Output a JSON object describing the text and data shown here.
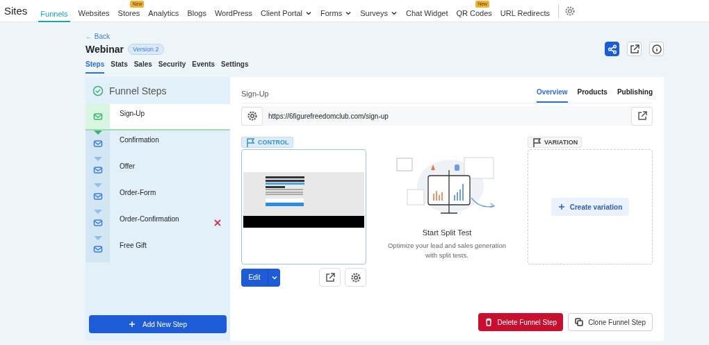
{
  "topnav": {
    "brand": "Sites",
    "items": [
      {
        "label": "Funnels",
        "selected": true,
        "dropdown": false
      },
      {
        "label": "Websites",
        "selected": false,
        "dropdown": false
      },
      {
        "label": "Stores",
        "selected": false,
        "badge": "New",
        "dropdown": false
      },
      {
        "label": "Analytics",
        "selected": false,
        "dropdown": false
      },
      {
        "label": "Blogs",
        "selected": false,
        "dropdown": false
      },
      {
        "label": "WordPress",
        "selected": false,
        "dropdown": false
      },
      {
        "label": "Client Portal",
        "selected": false,
        "dropdown": true
      },
      {
        "label": "Forms",
        "selected": false,
        "dropdown": true
      },
      {
        "label": "Surveys",
        "selected": false,
        "dropdown": true
      },
      {
        "label": "Chat Widget",
        "selected": false,
        "dropdown": false
      },
      {
        "label": "QR Codes",
        "selected": false,
        "badge": "New",
        "dropdown": false
      },
      {
        "label": "URL Redirects",
        "selected": false,
        "dropdown": false
      }
    ]
  },
  "back": "← Back",
  "funnel": {
    "title": "Webinar",
    "version": "Version 2"
  },
  "tabs": [
    {
      "label": "Steps",
      "selected": true
    },
    {
      "label": "Stats",
      "selected": false
    },
    {
      "label": "Sales",
      "selected": false
    },
    {
      "label": "Security",
      "selected": false
    },
    {
      "label": "Events",
      "selected": false
    },
    {
      "label": "Settings",
      "selected": false
    }
  ],
  "sidebar": {
    "title": "Funnel Steps",
    "steps": [
      {
        "label": "Sign-Up",
        "selected": true,
        "hovered": false
      },
      {
        "label": "Confirmation",
        "selected": false,
        "hovered": false
      },
      {
        "label": "Offer",
        "selected": false,
        "hovered": false
      },
      {
        "label": "Order-Form",
        "selected": false,
        "hovered": false
      },
      {
        "label": "Order-Confirmation",
        "selected": false,
        "hovered": true
      },
      {
        "label": "Free Gift",
        "selected": false,
        "hovered": false
      }
    ],
    "add_button": "Add New Step"
  },
  "step": {
    "title": "Sign-Up",
    "tabs": [
      {
        "label": "Overview",
        "selected": true
      },
      {
        "label": "Products",
        "selected": false
      },
      {
        "label": "Publishing",
        "selected": false
      }
    ],
    "url": "https://6figurefreedomclub.com/sign-up",
    "control_label": "CONTROL",
    "variation_label": "VARIATION",
    "edit_button": "Edit",
    "split_title": "Start Split Test",
    "split_text": "Optimize your lead and sales generation with split tests.",
    "create_variation": "Create variation",
    "delete_button": "Delete Funnel Step",
    "clone_button": "Clone Funnel Step"
  }
}
